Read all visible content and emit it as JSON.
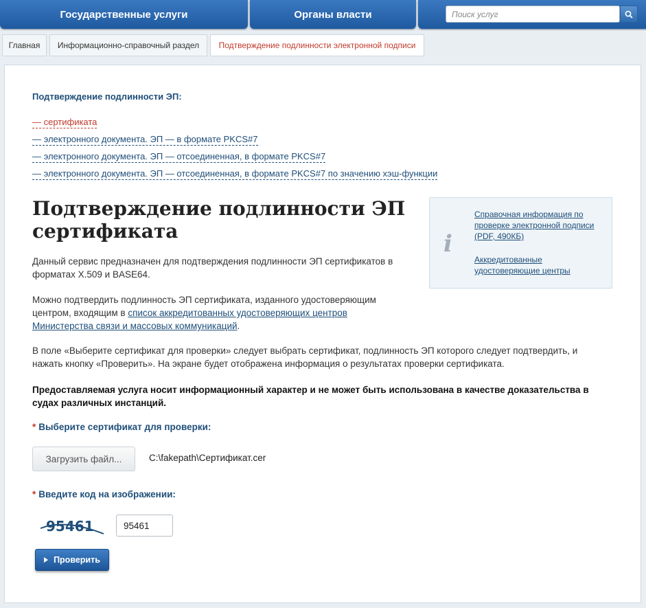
{
  "nav": {
    "tab_services": "Государственные услуги",
    "tab_authorities": "Органы власти",
    "search_placeholder": "Поиск услуг"
  },
  "breadcrumb": [
    "Главная",
    "Информационно-справочный раздел",
    "Подтверждение подлинности электронной подписи"
  ],
  "subnav": {
    "heading": "Подтверждение подлинности ЭП:",
    "links": [
      "— сертификата",
      "— электронного документа. ЭП — в формате PKCS#7",
      "— электронного документа. ЭП — отсоединенная, в формате PKCS#7",
      "— электронного документа. ЭП — отсоединенная, в формате PKCS#7 по значению хэш-функции"
    ]
  },
  "page": {
    "title_line1": "Подтверждение подлинности ЭП",
    "title_line2": "сертификата",
    "para1": "Данный сервис предназначен для подтверждения подлинности ЭП сертификатов в форматах X.509 и BASE64.",
    "para2_before": "Можно подтвердить подлинность ЭП сертификата, изданного удостоверяющим центром, входящим в ",
    "para2_link": "список аккредитованных удостоверяющих центров Министерства связи и массовых коммуникаций",
    "para2_after": ".",
    "para3": "В поле «Выберите сертификат для проверки» следует выбрать сертификат, подлинность ЭП которого следует подтвердить, и нажать кнопку «Проверить». На экране будет отображена информация о результатах проверки сертификата.",
    "notice": "Предоставляемая услуга носит информационный характер и не может быть использована в качестве доказательства в судах различных инстанций."
  },
  "info": {
    "link1": "Справочная информация по проверке электронной подписи (PDF, 490КБ)",
    "link2": "Аккредитованные удостоверяющие центры"
  },
  "form": {
    "required_mark": "*",
    "cert_label": "Выберите сертификат для проверки:",
    "upload_label": "Загрузить файл...",
    "file_path": "C:\\fakepath\\Сертификат.cer",
    "captcha_label": "Введите код на изображении:",
    "captcha_text": "95461",
    "captcha_value": "95461",
    "verify_label": "Проверить"
  },
  "colors": {
    "nav_blue": "#2a68b0",
    "link_blue": "#1f4e79",
    "active_red": "#c0392b"
  }
}
